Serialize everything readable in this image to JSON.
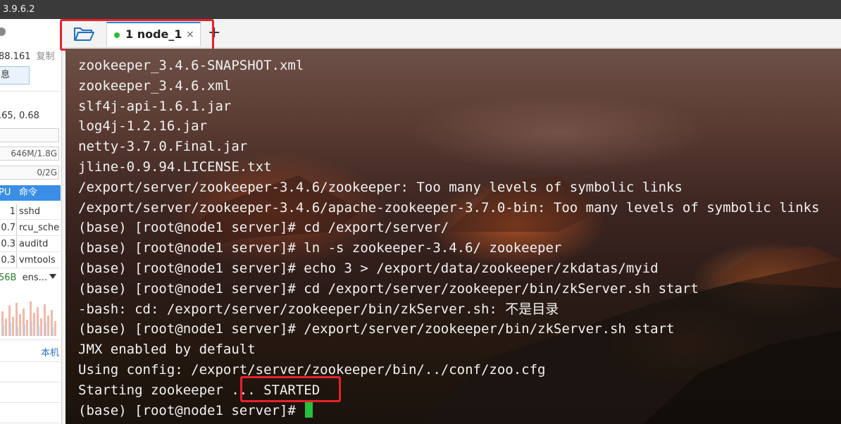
{
  "window": {
    "title": "3.9.6.2"
  },
  "sidebar": {
    "ip": "88.161",
    "copy_label": "复制",
    "info_label": "息",
    "load": ".65, 0.68",
    "memory": "646M/1.8G",
    "swap": "0/2G",
    "process_header": {
      "cpu": "PU",
      "command": "命令"
    },
    "processes": [
      {
        "cpu": "1",
        "name": "sshd"
      },
      {
        "cpu": "0.7",
        "name": "rcu_sche"
      },
      {
        "cpu": "0.3",
        "name": "auditd"
      },
      {
        "cpu": "0.3",
        "name": "vmtools"
      }
    ],
    "network": {
      "speed": "56B",
      "interface": "ens..."
    },
    "local_label": "本机"
  },
  "tabs": {
    "folder_icon": "folder-open-icon",
    "items": [
      {
        "label": "1 node_1",
        "status_color": "#2dbb35",
        "close": "×"
      }
    ],
    "add": "+"
  },
  "terminal": {
    "cursor_color": "#25c13a",
    "lines": [
      "zookeeper_3.4.6-SNAPSHOT.xml",
      "zookeeper_3.4.6.xml",
      "slf4j-api-1.6.1.jar",
      "log4j-1.2.16.jar",
      "netty-3.7.0.Final.jar",
      "jline-0.9.94.LICENSE.txt",
      "/export/server/zookeeper-3.4.6/zookeeper: Too many levels of symbolic links",
      "/export/server/zookeeper-3.4.6/apache-zookeeper-3.7.0-bin: Too many levels of symbolic links",
      "(base) [root@node1 server]# cd /export/server/",
      "(base) [root@node1 server]# ln -s zookeeper-3.4.6/ zookeeper",
      "(base) [root@node1 server]# echo 3 > /export/data/zookeeper/zkdatas/myid",
      "(base) [root@node1 server]# cd /export/server/zookeeper/bin/zkServer.sh start",
      "-bash: cd: /export/server/zookeeper/bin/zkServer.sh: 不是目录",
      "(base) [root@node1 server]# /export/server/zookeeper/bin/zkServer.sh start",
      "JMX enabled by default",
      "Using config: /export/server/zookeeper/bin/../conf/zoo.cfg",
      "Starting zookeeper ... STARTED"
    ],
    "prompt": "(base) [root@node1 server]#"
  },
  "highlight_color": "#e8212b"
}
